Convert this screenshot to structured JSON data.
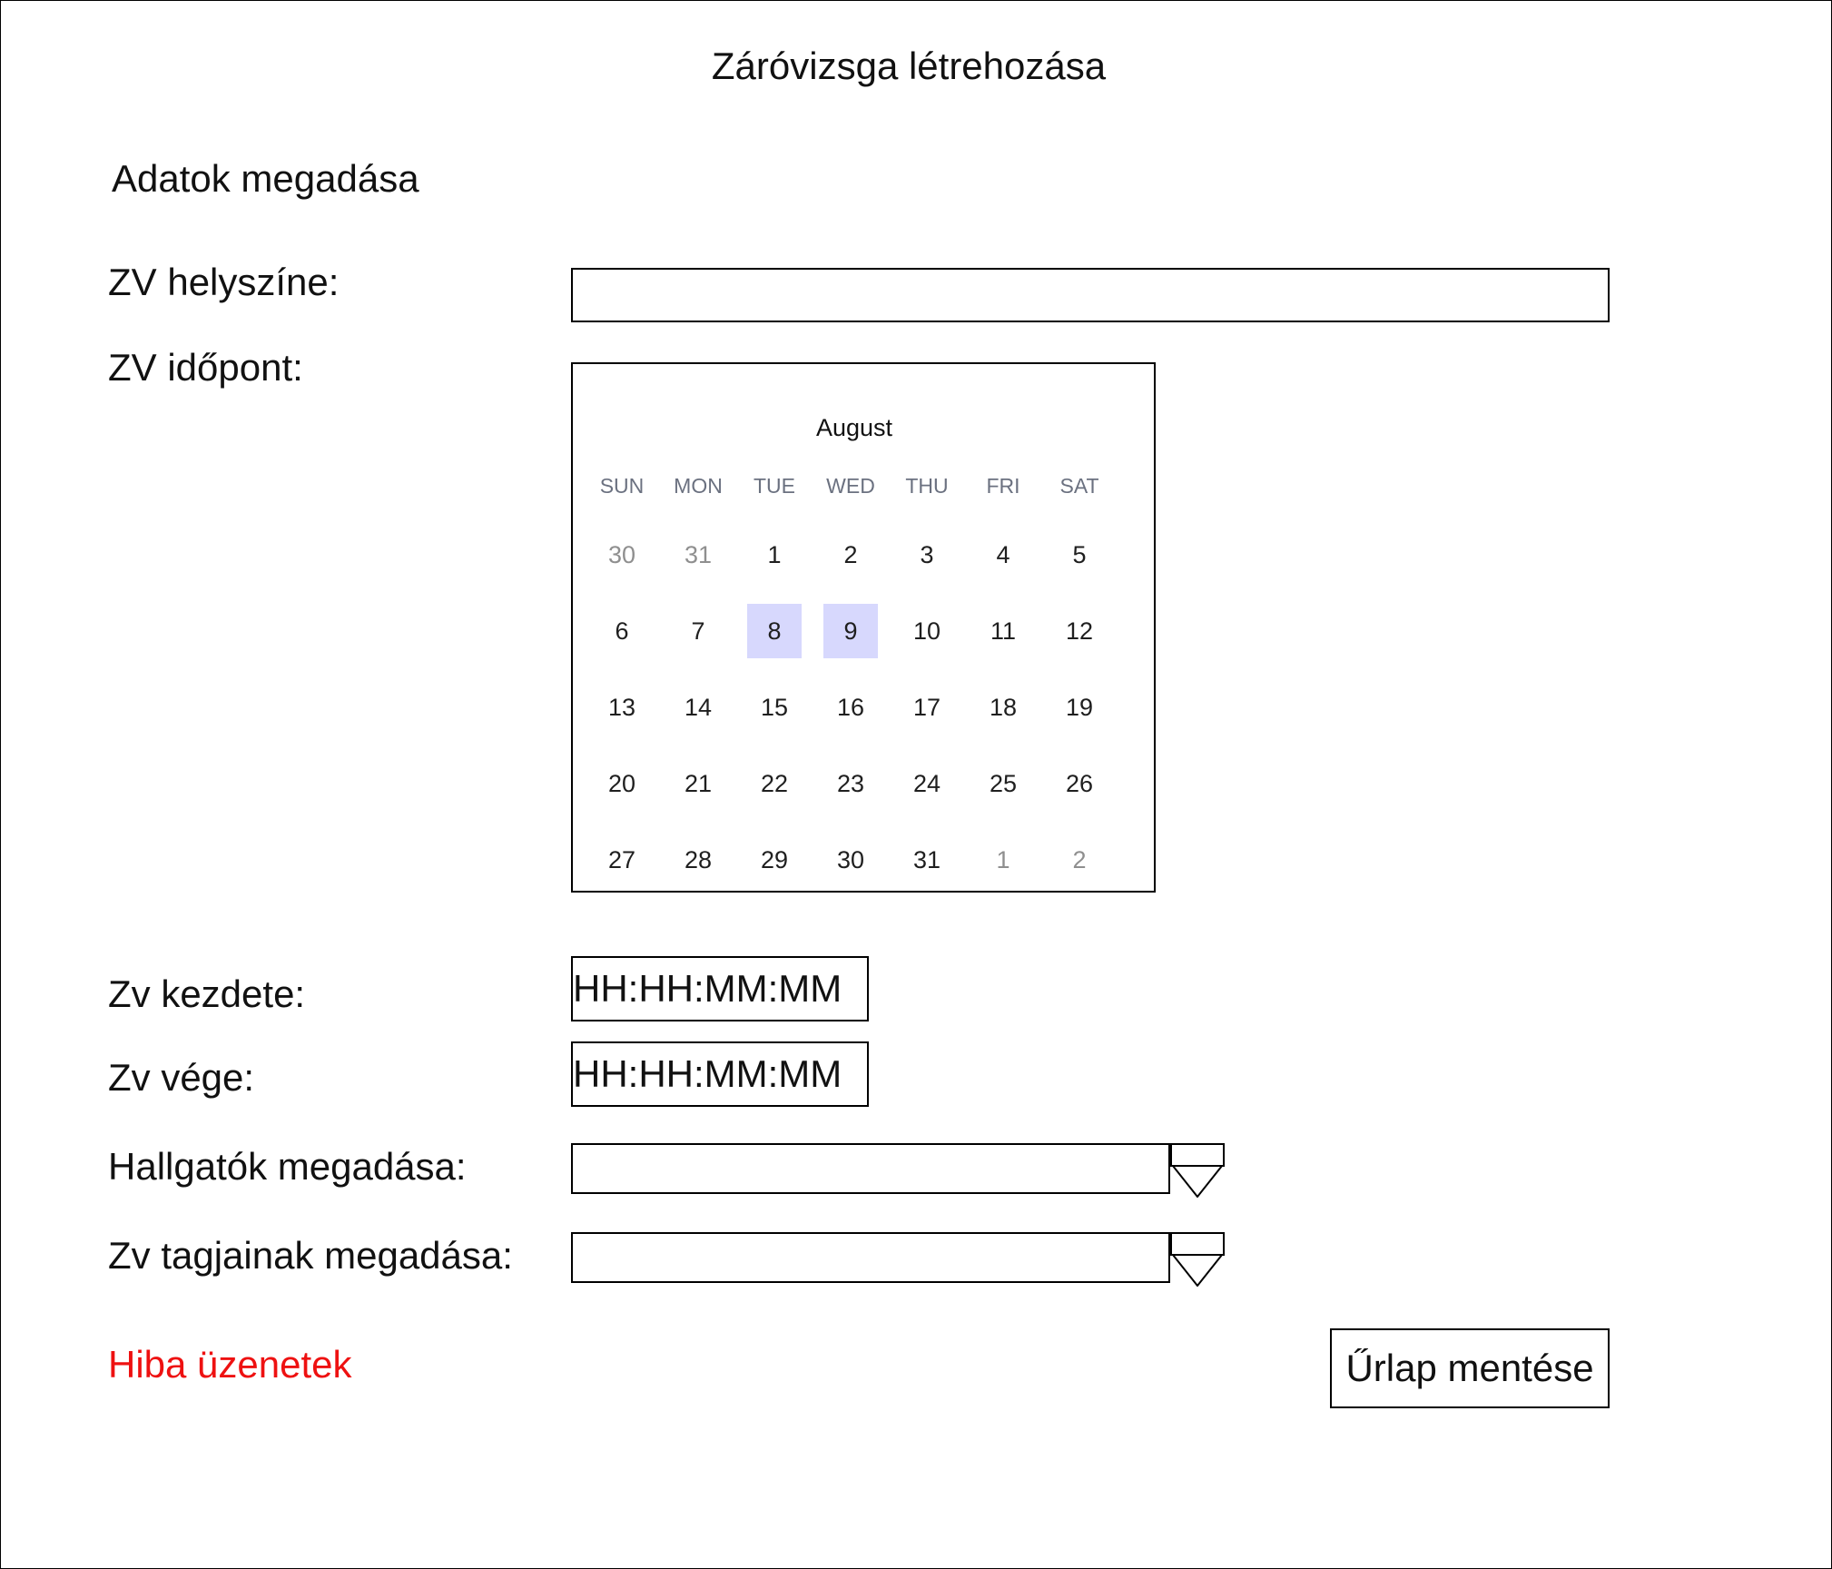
{
  "page": {
    "title": "Záróvizsga létrehozása",
    "section_title": "Adatok megadása"
  },
  "form": {
    "location_label": "ZV helyszíne:",
    "location_value": "",
    "date_label": "ZV időpont:",
    "start_label": "Zv kezdete:",
    "start_value": "HH:HH:MM:MM",
    "end_label": "Zv vége:",
    "end_value": "HH:HH:MM:MM",
    "students_label": "Hallgatók megadása:",
    "students_value": "",
    "members_label": "Zv tagjainak megadása:",
    "members_value": "",
    "error_text": "Hiba üzenetek",
    "save_label": "Űrlap mentése"
  },
  "calendar": {
    "month": "August",
    "weekdays": [
      "SUN",
      "MON",
      "TUE",
      "WED",
      "THU",
      "FRI",
      "SAT"
    ],
    "weeks": [
      [
        "30",
        "31",
        "1",
        "2",
        "3",
        "4",
        "5"
      ],
      [
        "6",
        "7",
        "8",
        "9",
        "10",
        "11",
        "12"
      ],
      [
        "13",
        "14",
        "15",
        "16",
        "17",
        "18",
        "19"
      ],
      [
        "20",
        "21",
        "22",
        "23",
        "24",
        "25",
        "26"
      ],
      [
        "27",
        "28",
        "29",
        "30",
        "31",
        "1",
        "2"
      ]
    ],
    "outside_month": [
      [
        0,
        0
      ],
      [
        0,
        1
      ],
      [
        4,
        5
      ],
      [
        4,
        6
      ]
    ],
    "selected": [
      [
        1,
        2
      ],
      [
        1,
        3
      ]
    ],
    "selected_color": "#d7d8fd"
  },
  "colors": {
    "error": "#ee1111",
    "weekday_header": "#6b7180"
  },
  "icons": {
    "dropdown_arrow": "triangle-down"
  }
}
